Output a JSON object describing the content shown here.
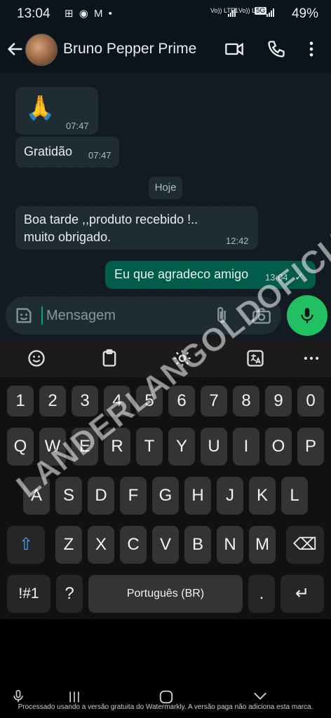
{
  "status_bar": {
    "time": "13:04",
    "sim1_label": "Vo)) LTE1",
    "sim2_label": "Vo)) LTE2",
    "network": "5G",
    "battery": "49%"
  },
  "header": {
    "contact_name": "Bruno Pepper Prime"
  },
  "messages": [
    {
      "text": "🙏",
      "time": "07:47"
    },
    {
      "text": "Gratidão",
      "time": "07:47"
    },
    {
      "text": "Boa tarde ,,produto recebido !..",
      "text2": "muito obrigado.",
      "time": "12:42"
    },
    {
      "text": "Eu que agradeco amigo",
      "time": "13:04",
      "status": "✓"
    }
  ],
  "date_separator": "Hoje",
  "input": {
    "placeholder": "Mensagem"
  },
  "watermark": "LANDERLANGOLDOFICIAL.COM.BR",
  "keyboard": {
    "row_numbers": [
      "1",
      "2",
      "3",
      "4",
      "5",
      "6",
      "7",
      "8",
      "9",
      "0"
    ],
    "row1": [
      "Q",
      "W",
      "E",
      "R",
      "T",
      "Y",
      "U",
      "I",
      "O",
      "P"
    ],
    "row2": [
      "A",
      "S",
      "D",
      "F",
      "G",
      "H",
      "J",
      "K",
      "L"
    ],
    "row3": [
      "Z",
      "X",
      "C",
      "V",
      "B",
      "N",
      "M"
    ],
    "symbols_key": "!#1",
    "question_key": "?",
    "space_label": "Português (BR)",
    "period_key": ".",
    "enter_symbol": "↵",
    "backspace_symbol": "⌫",
    "shift_symbol": "⇧"
  },
  "watermark_note": "Processado usando a versão gratuita do Watermarkly. A versão paga não adiciona esta marca.",
  "colors": {
    "accent": "#21c063",
    "outgoing_bubble": "#005c4b",
    "incoming_bubble": "#202c33"
  }
}
